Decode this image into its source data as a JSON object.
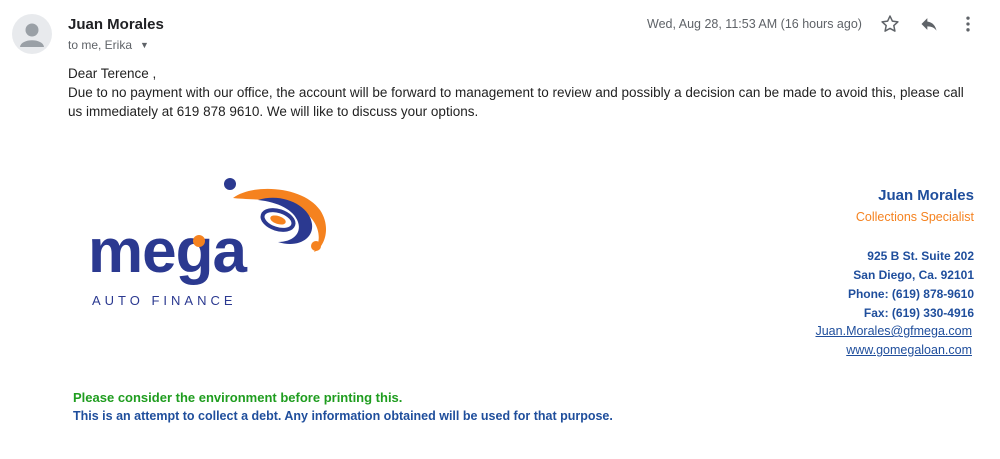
{
  "email": {
    "sender_name": "Juan Morales",
    "recipients": "to me, Erika",
    "timestamp": "Wed, Aug 28, 11:53 AM (16 hours ago)",
    "greeting": "Dear   Terence ,",
    "body": "Due to no payment with our office, the account will be forward to management to review and possibly a decision can be made to avoid this, please call us immediately at 619 878 9610. We will like to discuss your options."
  },
  "icons": {
    "star": "star-icon",
    "reply": "reply-icon",
    "more": "more-vertical-icon",
    "avatar": "person-icon"
  },
  "logo": {
    "wordmark": "mega",
    "tagline": "AUTO FINANCE",
    "colors": {
      "blue": "#2b3990",
      "orange": "#f5821f"
    }
  },
  "signature": {
    "name": "Juan Morales",
    "title": "Collections  Specialist",
    "address1": "925 B St. Suite 202",
    "address2": "San Diego, Ca. 92101",
    "phone": "Phone: (619) 878-9610",
    "fax": "Fax: (619) 330-4916",
    "email": "Juan.Morales@gfmega.com",
    "website": "www.gomegaloan.com"
  },
  "footer": {
    "environment": "Please consider the environment before printing this.",
    "disclaimer": "This is an attempt to collect a debt. Any information obtained will be used for that purpose."
  }
}
